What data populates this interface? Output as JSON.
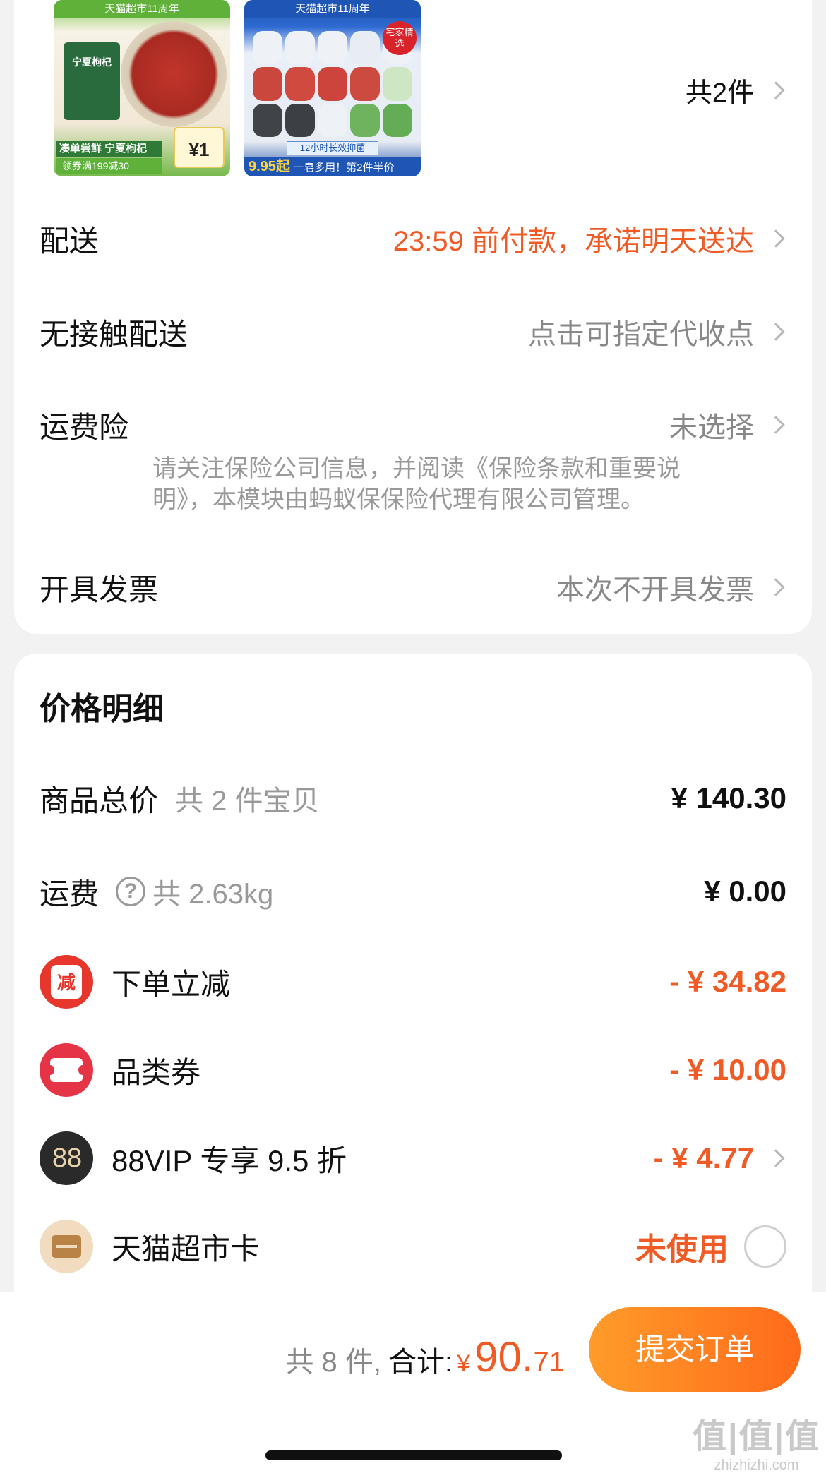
{
  "products": {
    "item1": {
      "banner": "天猫超市11周年",
      "bag_text": "宁夏枸杞",
      "tag": "凑单尝鲜 宁夏枸杞",
      "coupon": "领券满199减30",
      "price": "¥1"
    },
    "item2": {
      "banner": "天猫超市11周年",
      "corner_tag": "宅家精选",
      "strip": "12小时长效抑菌",
      "bottom_price": "9.95起",
      "bottom_text": "一皂多用！第2件半价"
    },
    "count_label": "共2件"
  },
  "delivery": {
    "label": "配送",
    "value": "23:59 前付款，承诺明天送达"
  },
  "contactless": {
    "label": "无接触配送",
    "value": "点击可指定代收点"
  },
  "shipping_insurance": {
    "label": "运费险",
    "value": "未选择",
    "note": "请关注保险公司信息，并阅读《保险条款和重要说明》，本模块由蚂蚁保保险代理有限公司管理。"
  },
  "invoice": {
    "label": "开具发票",
    "value": "本次不开具发票"
  },
  "price_detail": {
    "title": "价格明细",
    "subtotal": {
      "label": "商品总价",
      "sub": "共 2 件宝贝",
      "amount": "¥ 140.30"
    },
    "shipping": {
      "label": "运费",
      "sub": "共 2.63kg",
      "amount": "¥ 0.00"
    },
    "instant_discount": {
      "label": "下单立减",
      "badge": "减",
      "amount": "- ¥ 34.82"
    },
    "category_coupon": {
      "label": "品类券",
      "amount": "- ¥ 10.00"
    },
    "vip": {
      "label": "88VIP 专享 9.5 折",
      "badge": "88",
      "amount": "- ¥ 4.77"
    },
    "market_card": {
      "label": "天猫超市卡",
      "status": "未使用"
    }
  },
  "footer": {
    "count": "共 8 件,",
    "total_label": "合计:",
    "currency": "¥",
    "total_int": "90.",
    "total_dec": "71",
    "submit": "提交订单"
  },
  "watermark": {
    "line1": "值|值|值",
    "line2": "zhizhizhi.com"
  },
  "colors": {
    "accent": "#f05a24",
    "submit_start": "#ff9c2a",
    "submit_end": "#ff6a1a"
  }
}
